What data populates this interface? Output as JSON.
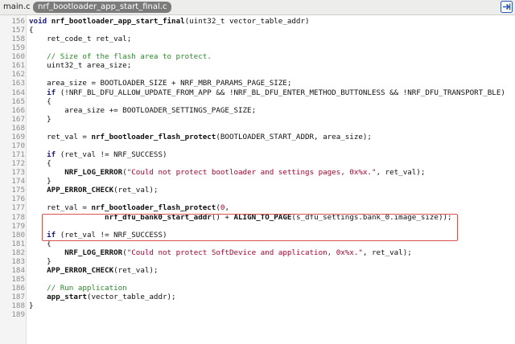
{
  "tabs": [
    {
      "label": "main.c",
      "active": false
    },
    {
      "label": "nrf_bootloader_app_start_final.c",
      "active": true
    }
  ],
  "nav_icon": "arrow-right-box-icon",
  "colors": {
    "keyword": "#1a1a8c",
    "string": "#b2002d",
    "comment": "#2a8a2a",
    "highlight_border": "#d9534f",
    "active_tab": "#7b7b7b",
    "nav_button": "#2a5bb8"
  },
  "lines": [
    {
      "n": "156",
      "seg": [
        [
          "kw",
          "void"
        ],
        [
          "",
          " "
        ],
        [
          "fn",
          "nrf_bootloader_app_start_final"
        ],
        [
          "",
          "(uint32_t vector_table_addr)"
        ]
      ]
    },
    {
      "n": "157",
      "seg": [
        [
          "",
          "{"
        ]
      ]
    },
    {
      "n": "158",
      "seg": [
        [
          "",
          "    ret_code_t ret_val;"
        ]
      ]
    },
    {
      "n": "159",
      "seg": [
        [
          "",
          ""
        ]
      ]
    },
    {
      "n": "160",
      "seg": [
        [
          "",
          "    "
        ],
        [
          "cm",
          "// Size of the flash area to protect."
        ]
      ]
    },
    {
      "n": "161",
      "seg": [
        [
          "",
          "    uint32_t area_size;"
        ]
      ]
    },
    {
      "n": "162",
      "seg": [
        [
          "",
          ""
        ]
      ]
    },
    {
      "n": "163",
      "seg": [
        [
          "",
          "    area_size = BOOTLOADER_SIZE + NRF_MBR_PARAMS_PAGE_SIZE;"
        ]
      ]
    },
    {
      "n": "164",
      "seg": [
        [
          "",
          "    "
        ],
        [
          "kw",
          "if"
        ],
        [
          "",
          " (!NRF_BL_DFU_ALLOW_UPDATE_FROM_APP && !NRF_BL_DFU_ENTER_METHOD_BUTTONLESS && !NRF_DFU_TRANSPORT_BLE)"
        ]
      ]
    },
    {
      "n": "165",
      "seg": [
        [
          "",
          "    {"
        ]
      ]
    },
    {
      "n": "166",
      "seg": [
        [
          "",
          "        area_size += BOOTLOADER_SETTINGS_PAGE_SIZE;"
        ]
      ]
    },
    {
      "n": "167",
      "seg": [
        [
          "",
          "    }"
        ]
      ]
    },
    {
      "n": "168",
      "seg": [
        [
          "",
          ""
        ]
      ]
    },
    {
      "n": "169",
      "seg": [
        [
          "",
          "    ret_val = "
        ],
        [
          "fn",
          "nrf_bootloader_flash_protect"
        ],
        [
          "",
          "(BOOTLOADER_START_ADDR, area_size);"
        ]
      ]
    },
    {
      "n": "170",
      "seg": [
        [
          "",
          ""
        ]
      ]
    },
    {
      "n": "171",
      "seg": [
        [
          "",
          "    "
        ],
        [
          "kw",
          "if"
        ],
        [
          "",
          " (ret_val != NRF_SUCCESS)"
        ]
      ]
    },
    {
      "n": "172",
      "seg": [
        [
          "",
          "    {"
        ]
      ]
    },
    {
      "n": "173",
      "seg": [
        [
          "",
          "        "
        ],
        [
          "mac",
          "NRF_LOG_ERROR"
        ],
        [
          "",
          "("
        ],
        [
          "str",
          "\"Could not protect bootloader and settings pages, 0x%x.\""
        ],
        [
          "",
          ", ret_val);"
        ]
      ]
    },
    {
      "n": "174",
      "seg": [
        [
          "",
          "    }"
        ]
      ]
    },
    {
      "n": "175",
      "seg": [
        [
          "",
          "    "
        ],
        [
          "mac",
          "APP_ERROR_CHECK"
        ],
        [
          "",
          "(ret_val);"
        ]
      ]
    },
    {
      "n": "176",
      "seg": [
        [
          "",
          ""
        ]
      ]
    },
    {
      "n": "177",
      "seg": [
        [
          "",
          "    ret_val = "
        ],
        [
          "fn",
          "nrf_bootloader_flash_protect"
        ],
        [
          "",
          "("
        ],
        [
          "num",
          "0"
        ],
        [
          "",
          ","
        ]
      ]
    },
    {
      "n": "178",
      "seg": [
        [
          "",
          "                 "
        ],
        [
          "fn",
          "nrf_dfu_bank0_start_addr"
        ],
        [
          "",
          "() + "
        ],
        [
          "mac",
          "ALIGN_TO_PAGE"
        ],
        [
          "",
          "(s_dfu_settings.bank_0.image_size));"
        ]
      ]
    },
    {
      "n": "179",
      "seg": [
        [
          "",
          ""
        ]
      ]
    },
    {
      "n": "180",
      "seg": [
        [
          "",
          "    "
        ],
        [
          "kw",
          "if"
        ],
        [
          "",
          " (ret_val != NRF_SUCCESS)"
        ]
      ]
    },
    {
      "n": "181",
      "seg": [
        [
          "",
          "    {"
        ]
      ]
    },
    {
      "n": "182",
      "seg": [
        [
          "",
          "        "
        ],
        [
          "mac",
          "NRF_LOG_ERROR"
        ],
        [
          "",
          "("
        ],
        [
          "str",
          "\"Could not protect SoftDevice and application, 0x%x.\""
        ],
        [
          "",
          ", ret_val);"
        ]
      ]
    },
    {
      "n": "183",
      "seg": [
        [
          "",
          "    }"
        ]
      ]
    },
    {
      "n": "184",
      "seg": [
        [
          "",
          "    "
        ],
        [
          "mac",
          "APP_ERROR_CHECK"
        ],
        [
          "",
          "(ret_val);"
        ]
      ]
    },
    {
      "n": "185",
      "seg": [
        [
          "",
          ""
        ]
      ]
    },
    {
      "n": "186",
      "seg": [
        [
          "",
          "    "
        ],
        [
          "cm",
          "// Run application"
        ]
      ]
    },
    {
      "n": "187",
      "seg": [
        [
          "",
          "    "
        ],
        [
          "fn",
          "app_start"
        ],
        [
          "",
          "(vector_table_addr);"
        ]
      ]
    },
    {
      "n": "188",
      "seg": [
        [
          "",
          "}"
        ]
      ]
    },
    {
      "n": "189",
      "seg": [
        [
          "",
          ""
        ]
      ]
    }
  ]
}
